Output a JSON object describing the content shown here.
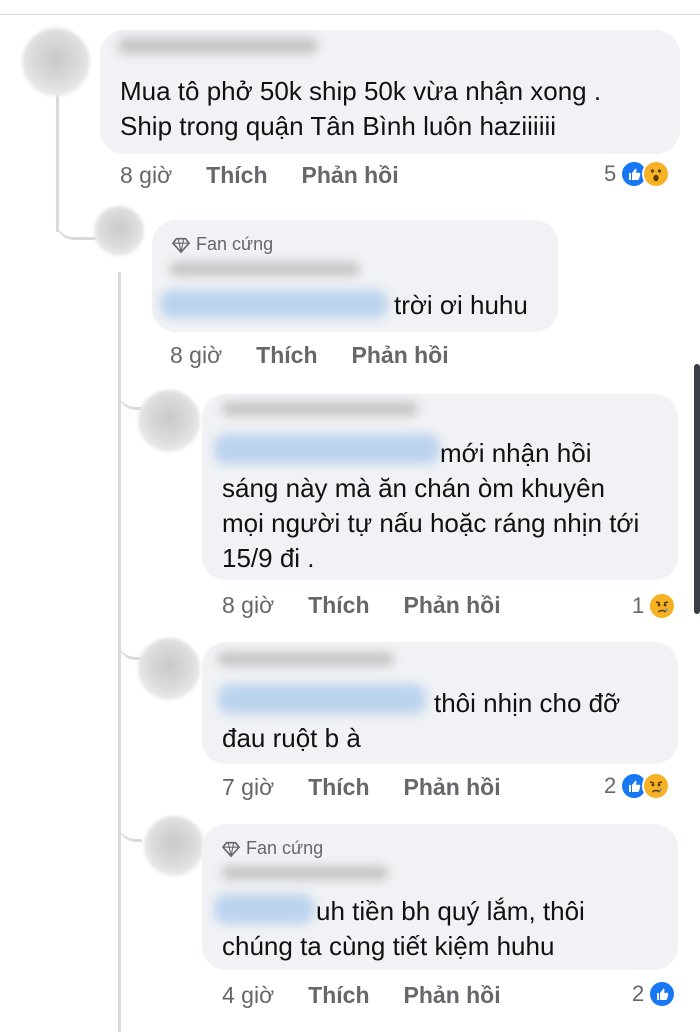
{
  "comments": [
    {
      "text_lines": [
        "Mua tô phở 50k ship 50k vừa nhận xong .",
        "Ship trong quận Tân Bình luôn haziiiiii"
      ],
      "time": "8 giờ",
      "like": "Thích",
      "reply": "Phản hồi",
      "reaction_count": "5",
      "reactions": [
        "like-icon",
        "wow-icon"
      ]
    },
    {
      "badge": "Fan cứng",
      "text_lines": [
        "trời ơi huhu"
      ],
      "time": "8 giờ",
      "like": "Thích",
      "reply": "Phản hồi"
    },
    {
      "text_lines": [
        "mới nhận hồi",
        "sáng này mà ăn chán òm khuyên",
        "mọi người tự nấu hoặc ráng nhịn tới",
        "15/9 đi ."
      ],
      "time": "8 giờ",
      "like": "Thích",
      "reply": "Phản hồi",
      "reaction_count": "1",
      "reactions": [
        "sad-icon"
      ]
    },
    {
      "text_lines": [
        "thôi nhịn cho đỡ",
        "đau ruột b à"
      ],
      "time": "7 giờ",
      "like": "Thích",
      "reply": "Phản hồi",
      "reaction_count": "2",
      "reactions": [
        "like-icon",
        "sad-icon"
      ]
    },
    {
      "badge": "Fan cứng",
      "text_lines": [
        "uh tiền bh quý lắm, thôi",
        "chúng ta cùng tiết kiệm huhu"
      ],
      "time": "4 giờ",
      "like": "Thích",
      "reply": "Phản hồi",
      "reaction_count": "2",
      "reactions": [
        "like-icon"
      ]
    }
  ],
  "colors": {
    "like": "#1877f2",
    "emoji": "#f7b125",
    "bubble": "#f0f2f5",
    "meta": "#65676b"
  }
}
